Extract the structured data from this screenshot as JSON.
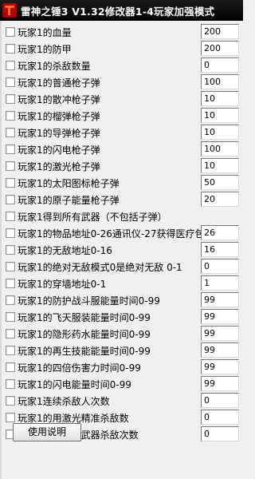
{
  "window": {
    "title": "雷神之锤3 V1.32修改器1-4玩家加强模式",
    "icon": "app-icon"
  },
  "rows": [
    {
      "label": "玩家1的血量",
      "value": "200",
      "has_value": true
    },
    {
      "label": "玩家1的防甲",
      "value": "200",
      "has_value": true
    },
    {
      "label": "玩家1的杀敌数量",
      "value": "0",
      "has_value": true
    },
    {
      "label": "玩家1的普通枪子弹",
      "value": "100",
      "has_value": true
    },
    {
      "label": "玩家1的散冲枪子弹",
      "value": "10",
      "has_value": true
    },
    {
      "label": "玩家1的榴弹枪子弹",
      "value": "10",
      "has_value": true
    },
    {
      "label": "玩家1的导弹枪子弹",
      "value": "10",
      "has_value": true
    },
    {
      "label": "玩家1的闪电枪子弹",
      "value": "100",
      "has_value": true
    },
    {
      "label": "玩家1的激光枪子弹",
      "value": "10",
      "has_value": true
    },
    {
      "label": "玩家1的太阳图标枪子弹",
      "value": "50",
      "has_value": true
    },
    {
      "label": "玩家1的原子能量枪子弹",
      "value": "20",
      "has_value": true
    },
    {
      "label": "玩家1得到所有武器（不包括子弹）",
      "value": "",
      "has_value": false
    },
    {
      "label": "玩家1的物品地址0-26通讯仪-27获得医疗包",
      "value": "26",
      "has_value": true
    },
    {
      "label": "玩家1的无敌地址0-16",
      "value": "16",
      "has_value": true
    },
    {
      "label": "玩家1的绝对无敌模式0是绝对无敌 0-1",
      "value": "0",
      "has_value": true
    },
    {
      "label": "玩家1的穿墙地址0-1",
      "value": "1",
      "has_value": true
    },
    {
      "label": "玩家1的防护战斗服能量时间0-99",
      "value": "99",
      "has_value": true
    },
    {
      "label": "玩家1的飞天服装能量时间0-99",
      "value": "99",
      "has_value": true
    },
    {
      "label": "玩家1的隐形药水能量时间0-99",
      "value": "99",
      "has_value": true
    },
    {
      "label": "玩家1的再生技能能量时间0-99",
      "value": "99",
      "has_value": true
    },
    {
      "label": "玩家1的四倍伤害力时间0-99",
      "value": "99",
      "has_value": true
    },
    {
      "label": "玩家1的闪电能量时间0-99",
      "value": "99",
      "has_value": true
    },
    {
      "label": "玩家1连续杀敌人次数",
      "value": "0",
      "has_value": true
    },
    {
      "label": "玩家1的用激光精准杀敌数",
      "value": "0",
      "has_value": true
    },
    {
      "label": "玩家1的用近身武器杀敌次数",
      "value": "0",
      "has_value": true
    }
  ],
  "help_button": {
    "label": "使用说明"
  }
}
